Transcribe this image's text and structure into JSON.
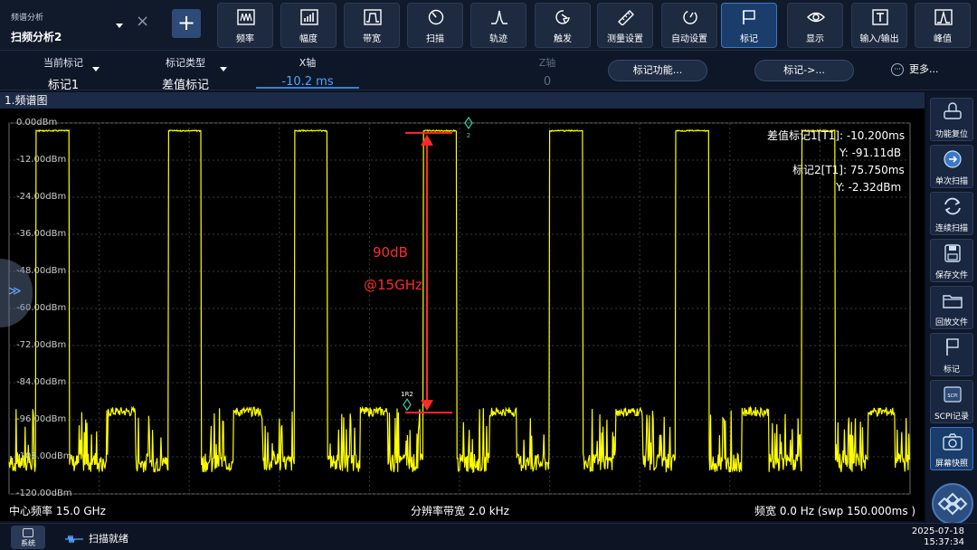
{
  "header": {
    "doc_sub": "频谱分析",
    "doc_main": "扫频分析2",
    "close_glyph": "×",
    "add_glyph": "+"
  },
  "toolbar": [
    {
      "label": "频率",
      "icon": "frequency-icon"
    },
    {
      "label": "幅度",
      "icon": "amplitude-icon"
    },
    {
      "label": "带宽",
      "icon": "bandwidth-icon"
    },
    {
      "label": "扫描",
      "icon": "sweep-icon"
    },
    {
      "label": "轨迹",
      "icon": "trace-icon"
    },
    {
      "label": "触发",
      "icon": "trigger-icon"
    },
    {
      "label": "测量设置",
      "icon": "measure-setup-icon"
    },
    {
      "label": "自动设置",
      "icon": "auto-setup-icon"
    },
    {
      "label": "标记",
      "icon": "marker-flag-icon",
      "active": true
    },
    {
      "label": "显示",
      "icon": "display-eye-icon"
    },
    {
      "label": "输入/输出",
      "icon": "input-output-icon"
    },
    {
      "label": "峰值",
      "icon": "peak-icon"
    }
  ],
  "marker_bar": {
    "current_marker_title": "当前标记",
    "current_marker_value": "标记1",
    "marker_type_title": "标记类型",
    "marker_type_value": "差值标记",
    "x_axis_title": "X轴",
    "x_axis_value": "-10.2 ms",
    "z_axis_title": "Z轴",
    "z_axis_value": "0",
    "marker_function_button": "标记功能...",
    "marker_to_button": "标记->...",
    "more_button": "更多...",
    "more_glyph": "···"
  },
  "panel": {
    "title": "1.频谱图",
    "side_handle_glyph": "≫"
  },
  "readout": {
    "delta_line1": "差值标记1[T1]:  -10.200ms",
    "delta_line2": "Y: -91.11dB",
    "marker2_line1": "标记2[T1]:   75.750ms",
    "marker2_line2": "Y: -2.32dBm"
  },
  "annotation": {
    "value": "90dB",
    "freq": "@15GHz"
  },
  "marker_labels": {
    "m2": "2",
    "m1r2": "1R2"
  },
  "bottom": {
    "center_freq": "中心频率 15.0 GHz",
    "rbw": "分辨率带宽 2.0 kHz",
    "span": "频宽 0.0 Hz (swp 150.000ms )"
  },
  "sidebar": [
    {
      "label": "功能复位",
      "icon": "function-reset-icon"
    },
    {
      "label": "单次扫描",
      "icon": "single-sweep-icon"
    },
    {
      "label": "连续扫描",
      "icon": "continuous-sweep-icon"
    },
    {
      "label": "保存文件",
      "icon": "save-file-icon"
    },
    {
      "label": "回放文件",
      "icon": "playback-file-icon"
    },
    {
      "label": "标记",
      "icon": "marker-flag-icon"
    },
    {
      "label": "SCPI记录",
      "icon": "scpi-record-icon"
    },
    {
      "label": "屏幕快照",
      "icon": "screenshot-camera-icon"
    }
  ],
  "status": {
    "system": "系统",
    "scan_state": "扫描就绪",
    "date": "2025-07-18",
    "time": "15:37:34"
  },
  "colors": {
    "trace": "#ffff00",
    "annotation": "#ff2a2a",
    "accent": "#3b78c8",
    "marker": "#3ad0b0"
  },
  "chart_data": {
    "type": "line",
    "title": "1.频谱图",
    "xlabel": "",
    "ylabel": "",
    "y_ticks": [
      "0.00dBm",
      "-12.00dBm",
      "-24.00dBm",
      "-36.00dBm",
      "-48.00dBm",
      "-60.00dBm",
      "-72.00dBm",
      "-84.00dBm",
      "-96.00dBm",
      "-108.00dBm",
      "-120.00dBm"
    ],
    "ylim": [
      -120,
      0
    ],
    "xlim_ms": [
      -75,
      75
    ],
    "grid": true,
    "pulse_high_dbm": -2.3,
    "pulse_low_dbm": -93.4,
    "noise_floor_dbm": -110,
    "x_center_note": "time domain, zero span",
    "pulse_rise_times_ms": [
      -70.5,
      -59,
      -48.5,
      -38,
      -27.5,
      -17,
      -6,
      4.5,
      15,
      25.5,
      36,
      46.5,
      57,
      67.5
    ],
    "pulse_width_ms": 5.5,
    "series": [
      {
        "name": "",
        "levels_dbm": [
          -2.3,
          -92.5,
          -2.3,
          -92.8,
          -2.3,
          -93.4,
          -2.3,
          -92.6,
          -2.3,
          -92.9,
          -2.3,
          -93.0,
          -2.3,
          -92.7,
          -2.3
        ]
      }
    ],
    "markers": [
      {
        "label": "2",
        "x_ms": 75.75,
        "y_dbm": -2.32
      },
      {
        "label": "1R2",
        "x_ms": 65.55,
        "y_dbm": -93.43
      }
    ]
  }
}
